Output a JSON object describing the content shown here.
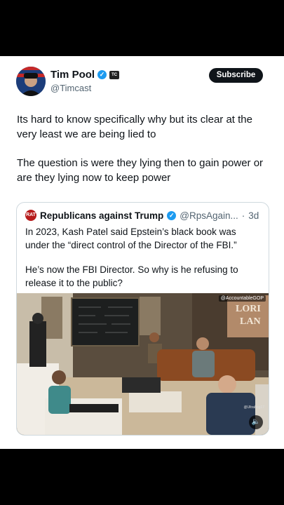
{
  "author": {
    "name": "Tim Pool",
    "handle": "@Timcast",
    "subscribe_label": "Subscribe"
  },
  "tweet": {
    "paragraph1": "Its hard to know specifically why but its clear at the very least we are being lied to",
    "paragraph2": "The question is were they lying then to gain power or are they lying now to keep power"
  },
  "quote": {
    "name": "Republicans against Trump",
    "handle": "@RpsAgain...",
    "separator": "·",
    "time": "3d",
    "paragraph1": "In 2023, Kash Patel said Epstein’s black book was under the “direct control of the Director of the FBI.”",
    "paragraph2": "He’s now the FBI Director. So why is he refusing to release it to the public?"
  },
  "media": {
    "watermark": "@AccountableGOP",
    "credit": "@Ultrahog17",
    "mute_icon": "speaker-icon"
  },
  "colors": {
    "verified": "#1d9bf0",
    "text": "#0f1419",
    "muted": "#536471",
    "border": "#cfd9de"
  }
}
